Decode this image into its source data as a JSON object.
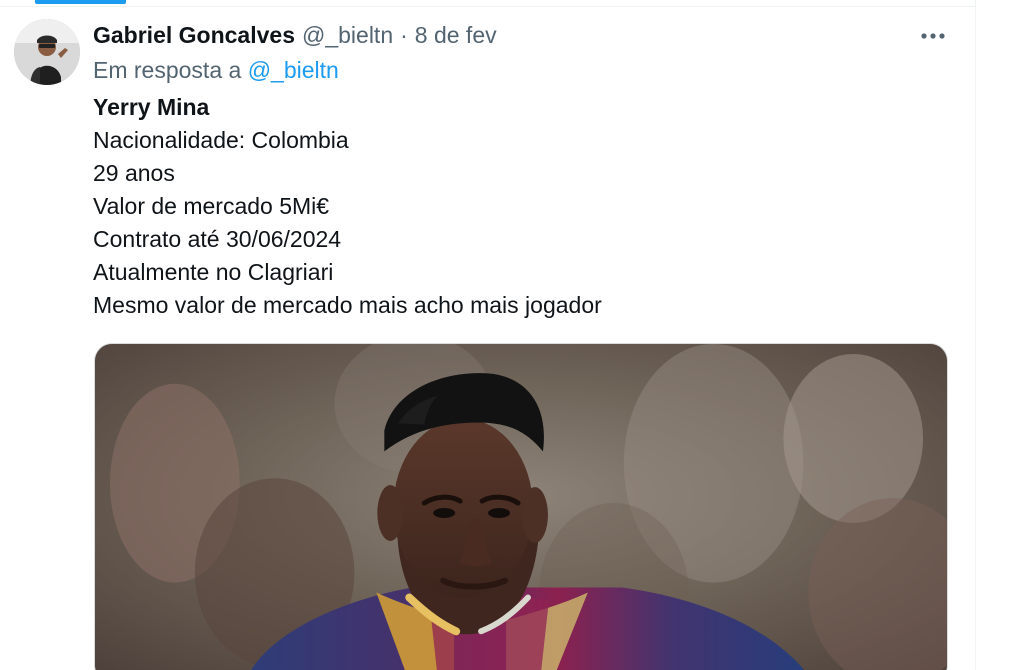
{
  "tweet": {
    "author_name": "Gabriel Goncalves",
    "author_handle": "@_bieltn",
    "separator": "·",
    "date": "8 de fev",
    "reply_prefix": "Em resposta a",
    "reply_handle": "@_bieltn",
    "lines": [
      "Yerry Mina",
      "Nacionalidade: Colombia",
      "29 anos",
      "Valor de mercado 5Mi€",
      "Contrato até 30/06/2024",
      "Atualmente no Clagriari",
      "Mesmo valor de mercado mais acho mais jogador"
    ]
  },
  "icons": {
    "more": "more-horizontal-icon",
    "avatar": "avatar-image",
    "media": "football-player-photo"
  },
  "colors": {
    "accent": "#1d9bf0",
    "muted": "#536471",
    "text": "#0f1419"
  }
}
